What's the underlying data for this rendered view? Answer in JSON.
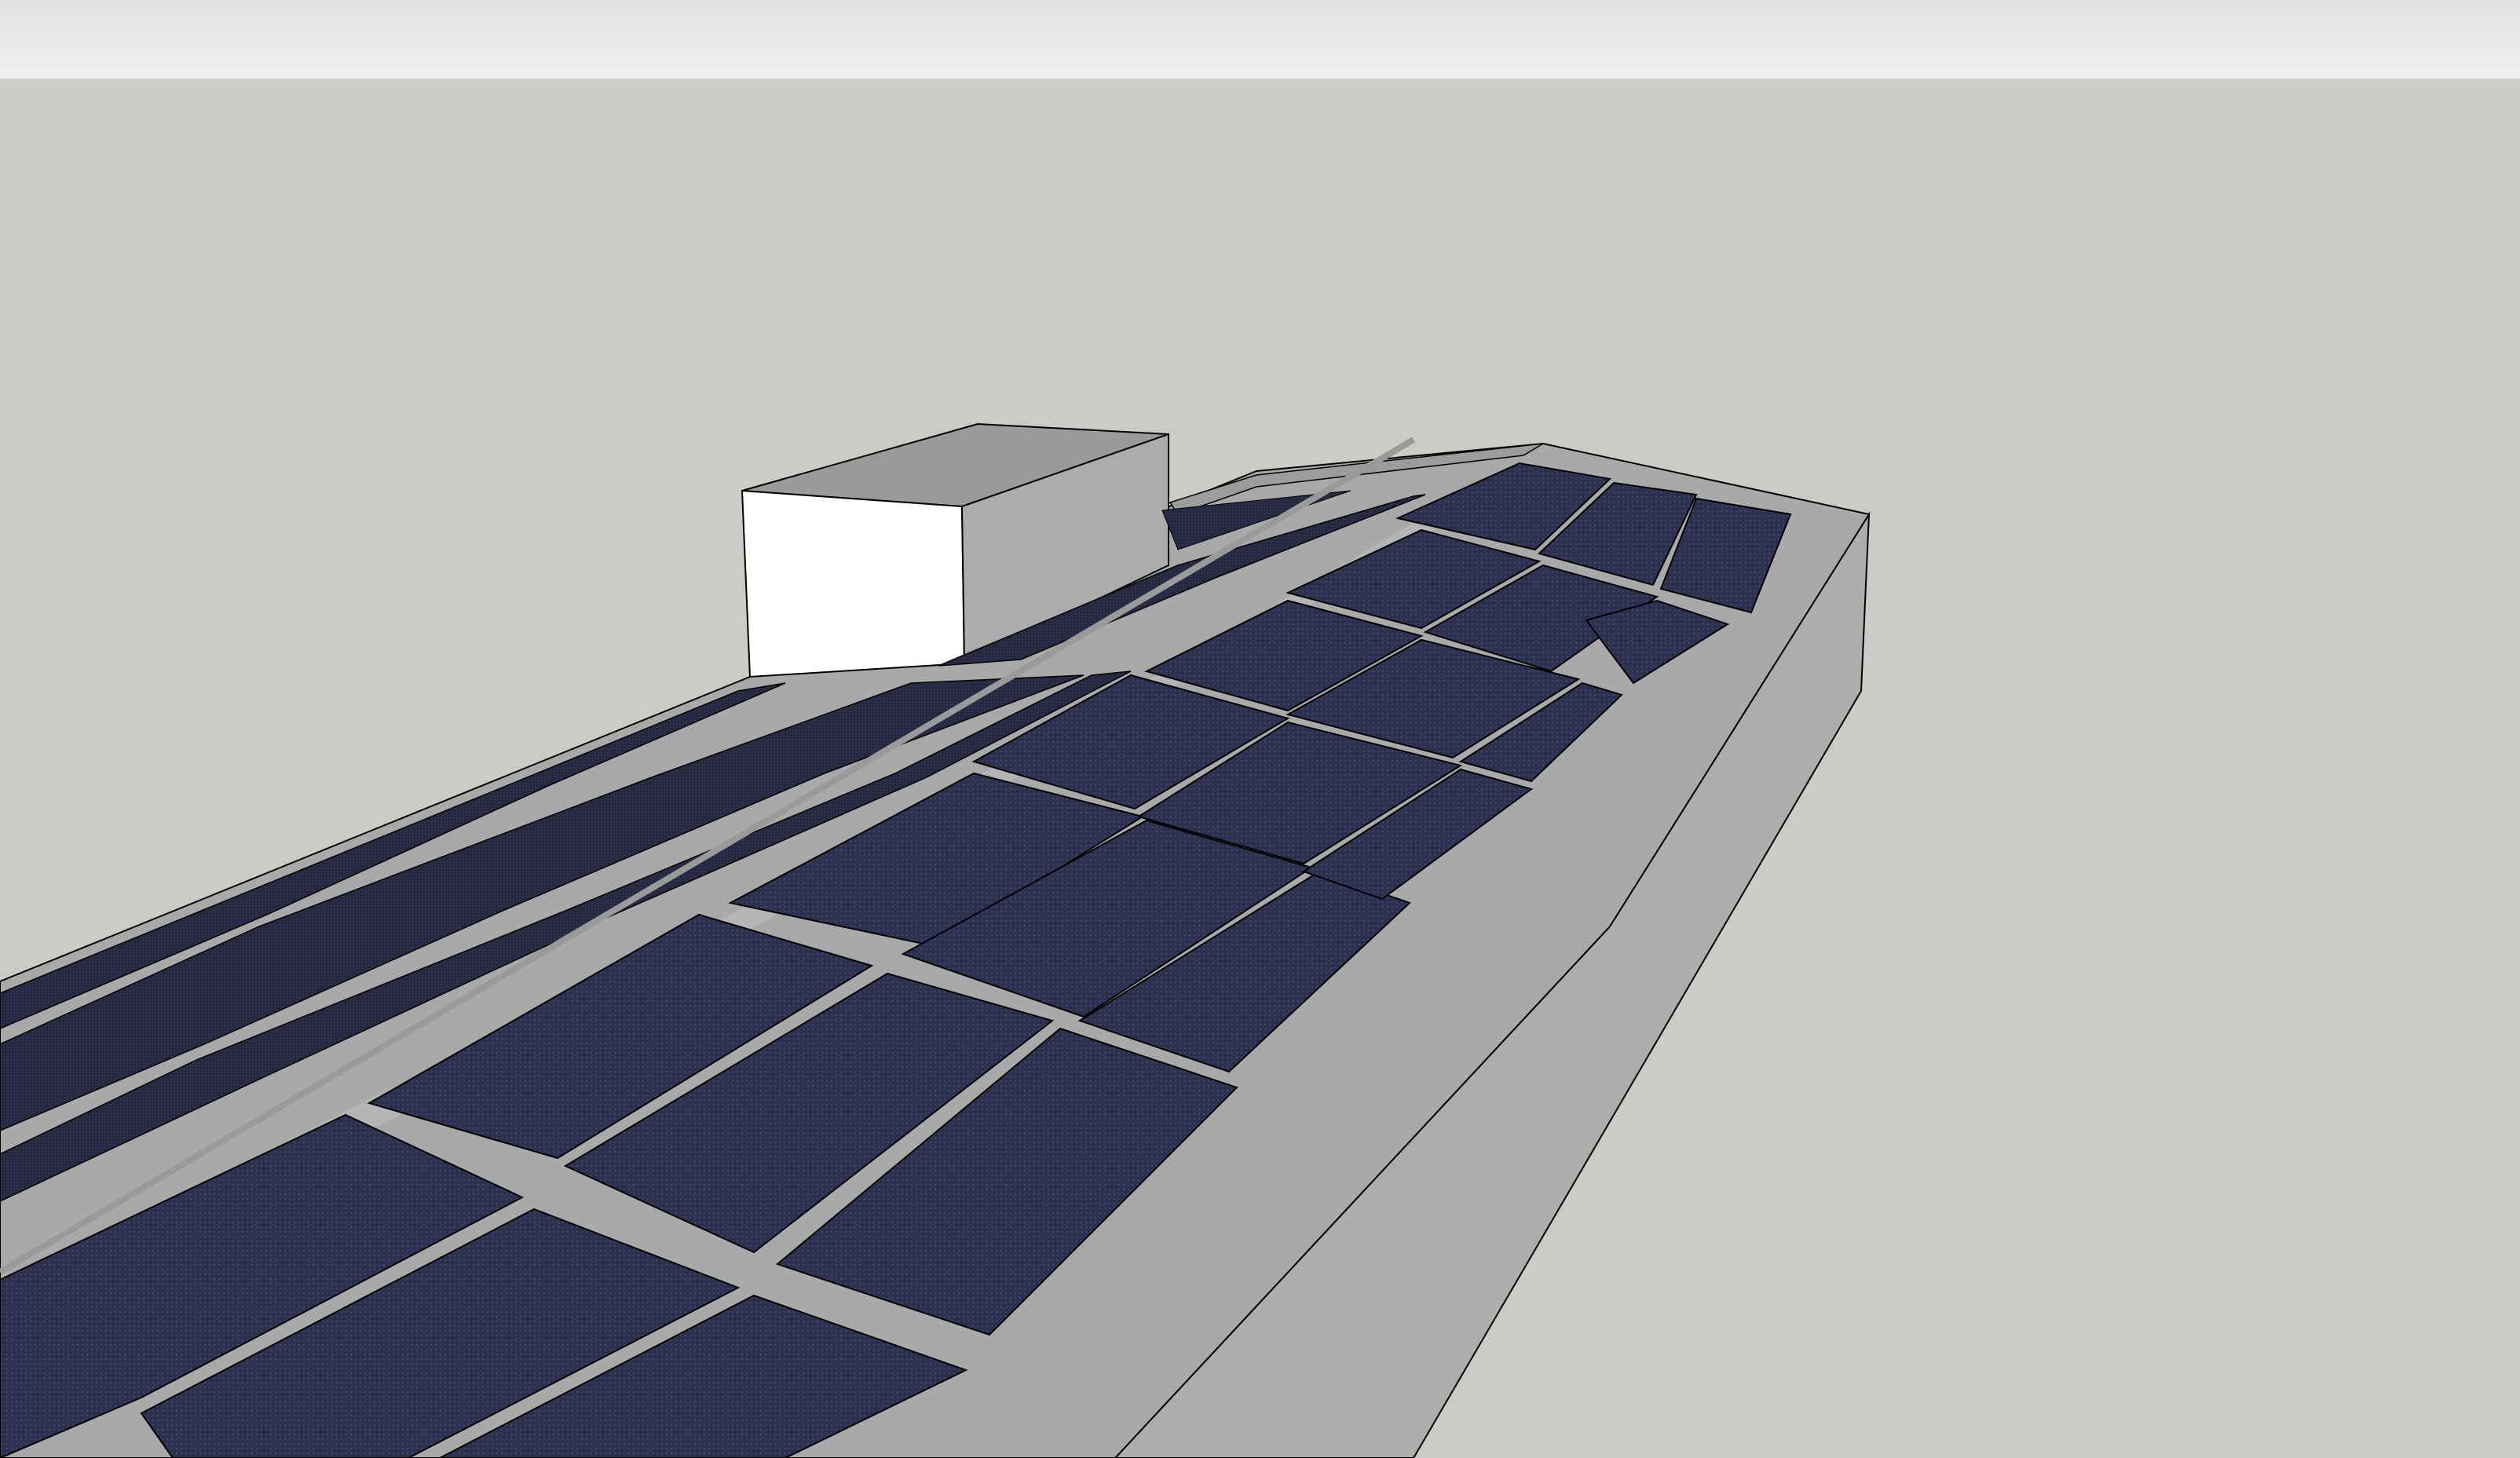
{
  "colors": {
    "sky": "#cbccc6",
    "roof_gray": "#a6a6a6",
    "wall_gray": "#adadad",
    "wall_white": "#ffffff",
    "panel": "#2c2d47",
    "panel_dark": "#1c1c2a",
    "edge": "#000000"
  },
  "scene": {
    "objects": [
      "building",
      "rooftop-unit",
      "solar-panel-array"
    ],
    "panel_rows_near": 3,
    "panel_rows_far": 2
  }
}
